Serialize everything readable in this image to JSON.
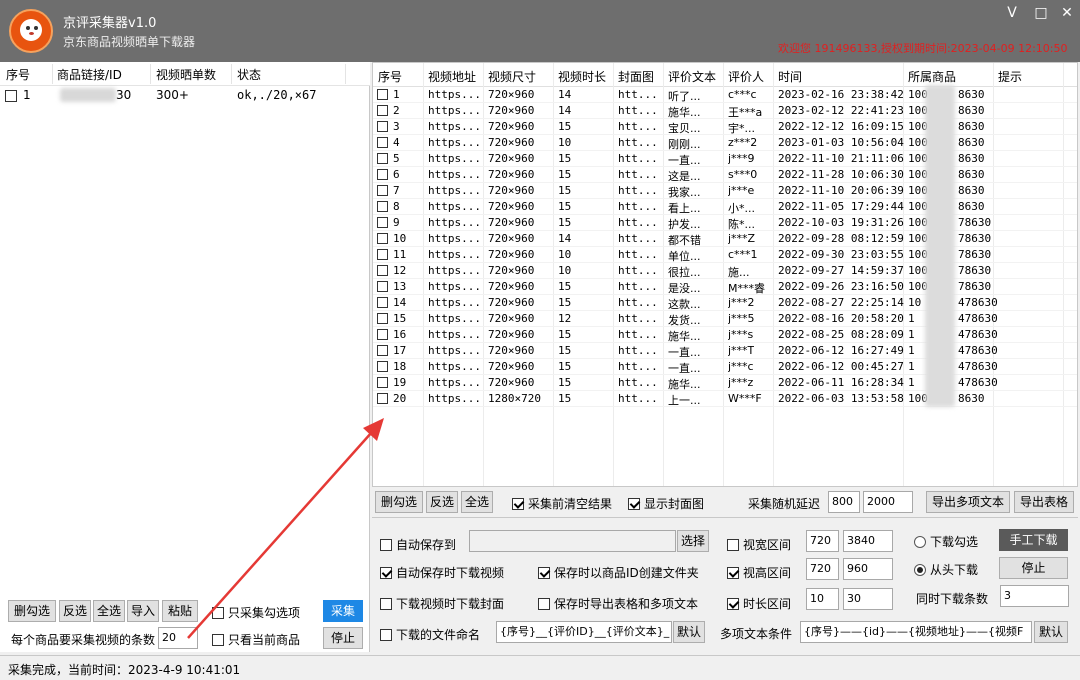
{
  "window": {
    "title": "京评采集器v1.0",
    "subtitle": "京东商品视频晒单下载器",
    "min_glyph": "V",
    "max_glyph": "□",
    "close_glyph": "✕",
    "welcome": "欢迎您 191496133,授权到期时间:2023-04-09 12:10:50"
  },
  "left_table": {
    "headers": [
      "序号",
      "商品链接/ID",
      "视频晒单数",
      "状态"
    ],
    "row": {
      "index": "1",
      "id_suffix": "30",
      "count": "300+",
      "status": "ok,./20,×67"
    }
  },
  "left_controls": {
    "uncheck_btn": "删勾选",
    "invert_btn": "反选",
    "selectall_btn": "全选",
    "import_btn": "导入",
    "paste_btn": "粘贴",
    "only_checked": "只采集勾选项",
    "only_current": "只看当前商品",
    "collect_btn": "采集",
    "stop_btn": "停止",
    "per_item_label": "每个商品要采集视频的条数",
    "per_item_value": "20"
  },
  "grid": {
    "headers": [
      "序号",
      "视频地址",
      "视频尺寸",
      "视频时长",
      "封面图",
      "评价文本",
      "评价人",
      "时间",
      "所属商品",
      "提示"
    ],
    "url_text": "https...",
    "cover_text": "htt...",
    "product_prefix": "100",
    "product_suffix": "8630",
    "rows": [
      {
        "n": "1",
        "size": "720×960",
        "dur": "14",
        "text": "听了...",
        "user": "c***c",
        "time": "2023-02-16 23:38:42",
        "pre": "100",
        "suf": "8630"
      },
      {
        "n": "2",
        "size": "720×960",
        "dur": "14",
        "text": "施华...",
        "user": "王***a",
        "time": "2023-02-12 22:41:23",
        "pre": "100",
        "suf": "8630"
      },
      {
        "n": "3",
        "size": "720×960",
        "dur": "15",
        "text": "宝贝...",
        "user": "宇*...",
        "time": "2022-12-12 16:09:15",
        "pre": "100",
        "suf": "8630"
      },
      {
        "n": "4",
        "size": "720×960",
        "dur": "10",
        "text": "刚刚...",
        "user": "z***2",
        "time": "2023-01-03 10:56:04",
        "pre": "100",
        "suf": "8630"
      },
      {
        "n": "5",
        "size": "720×960",
        "dur": "15",
        "text": "一直...",
        "user": "j***9",
        "time": "2022-11-10 21:11:06",
        "pre": "100",
        "suf": "8630"
      },
      {
        "n": "6",
        "size": "720×960",
        "dur": "15",
        "text": "这是...",
        "user": "s***0",
        "time": "2022-11-28 10:06:30",
        "pre": "100",
        "suf": "8630"
      },
      {
        "n": "7",
        "size": "720×960",
        "dur": "15",
        "text": "我家...",
        "user": "j***e",
        "time": "2022-11-10 20:06:39",
        "pre": "100",
        "suf": "8630"
      },
      {
        "n": "8",
        "size": "720×960",
        "dur": "15",
        "text": "看上...",
        "user": "小*...",
        "time": "2022-11-05 17:29:44",
        "pre": "100",
        "suf": "8630"
      },
      {
        "n": "9",
        "size": "720×960",
        "dur": "15",
        "text": "护发...",
        "user": "陈*...",
        "time": "2022-10-03 19:31:26",
        "pre": "100",
        "suf": "78630"
      },
      {
        "n": "10",
        "size": "720×960",
        "dur": "14",
        "text": "都不错",
        "user": "j***Z",
        "time": "2022-09-28 08:12:59",
        "pre": "100",
        "suf": "78630"
      },
      {
        "n": "11",
        "size": "720×960",
        "dur": "10",
        "text": "单位...",
        "user": "c***1",
        "time": "2022-09-30 23:03:55",
        "pre": "100",
        "suf": "78630"
      },
      {
        "n": "12",
        "size": "720×960",
        "dur": "10",
        "text": "很拉...",
        "user": "施...",
        "time": "2022-09-27 14:59:37",
        "pre": "100",
        "suf": "78630"
      },
      {
        "n": "13",
        "size": "720×960",
        "dur": "15",
        "text": "是没...",
        "user": "M***睿",
        "time": "2022-09-26 23:16:50",
        "pre": "100",
        "suf": "78630"
      },
      {
        "n": "14",
        "size": "720×960",
        "dur": "15",
        "text": "这款...",
        "user": "j***2",
        "time": "2022-08-27 22:25:14",
        "pre": "10",
        "suf": "478630"
      },
      {
        "n": "15",
        "size": "720×960",
        "dur": "12",
        "text": "发货...",
        "user": "j***5",
        "time": "2022-08-16 20:58:20",
        "pre": "1",
        "suf": "478630"
      },
      {
        "n": "16",
        "size": "720×960",
        "dur": "15",
        "text": "施华...",
        "user": "j***s",
        "time": "2022-08-25 08:28:09",
        "pre": "1",
        "suf": "478630"
      },
      {
        "n": "17",
        "size": "720×960",
        "dur": "15",
        "text": "一直...",
        "user": "j***T",
        "time": "2022-06-12 16:27:49",
        "pre": "1",
        "suf": "478630"
      },
      {
        "n": "18",
        "size": "720×960",
        "dur": "15",
        "text": "一直...",
        "user": "j***c",
        "time": "2022-06-12 00:45:27",
        "pre": "1",
        "suf": "478630"
      },
      {
        "n": "19",
        "size": "720×960",
        "dur": "15",
        "text": "施华...",
        "user": "j***z",
        "time": "2022-06-11 16:28:34",
        "pre": "1",
        "suf": "478630"
      },
      {
        "n": "20",
        "size": "1280×720",
        "dur": "15",
        "text": "上一...",
        "user": "W***F",
        "time": "2022-06-03 13:53:58",
        "pre": "100",
        "suf": "8630"
      }
    ]
  },
  "grid_controls": {
    "uncheck_btn": "删勾选",
    "invert_btn": "反选",
    "selectall_btn": "全选",
    "clear_before": "采集前清空结果",
    "show_cover": "显示封面图",
    "delay_label": "采集随机延迟",
    "delay_min": "800",
    "delay_max": "2000",
    "export_multi_btn": "导出多项文本",
    "export_table_btn": "导出表格"
  },
  "settings": {
    "auto_save_to": "自动保存到",
    "choose_btn": "选择",
    "auto_save_video": "自动保存时下载视频",
    "create_folder": "保存时以商品ID创建文件夹",
    "download_cover": "下载视频时下载封面",
    "export_on_save": "保存时导出表格和多项文本",
    "file_naming": "下载的文件命名",
    "naming_value": "{序号}__{评价ID}__{评价文本}_",
    "default_btn": "默认",
    "width_range": "视宽区间",
    "width_min": "720",
    "width_max": "3840",
    "height_range": "视高区间",
    "height_min": "720",
    "height_max": "960",
    "dur_range": "时长区间",
    "dur_min": "10",
    "dur_max": "30",
    "multi_cond_label": "多项文本条件",
    "multi_cond_value": "{序号}——{id}——{视频地址}——{视频F",
    "default_btn2": "默认",
    "download_checked": "下载勾选",
    "from_start": "从头下载",
    "manual_btn": "手工下载",
    "stop_btn": "停止",
    "concurrent_label": "同时下载条数",
    "concurrent_value": "3"
  },
  "status": {
    "text": "采集完成，当前时间：2023-4-9 10:41:01"
  },
  "colors": {
    "titlebar": "#6e6e6e",
    "accent_blue": "#1e88e5",
    "welcome_red": "#e02020",
    "arrow_red": "#e53935"
  }
}
